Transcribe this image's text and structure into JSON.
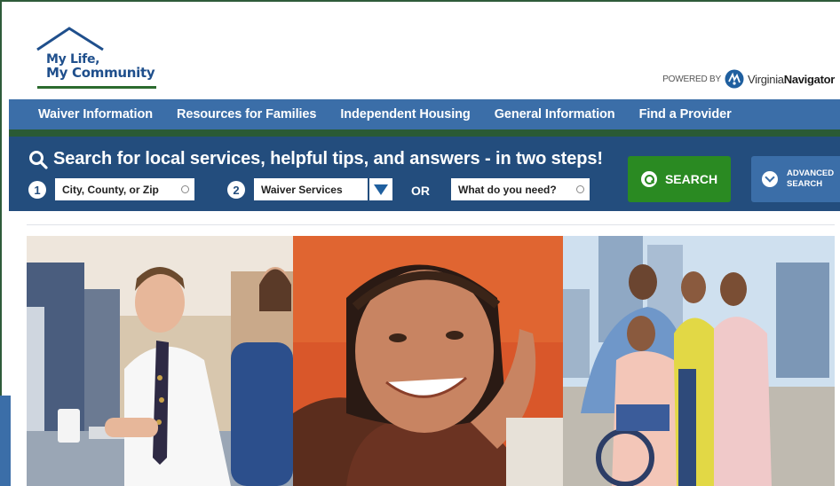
{
  "header": {
    "logo": {
      "line1": "My Life,",
      "line2": "My Community"
    },
    "powered_by": {
      "label": "POWERED BY",
      "brand_light": "Virginia",
      "brand_bold": "Navigator"
    }
  },
  "nav": {
    "items": [
      {
        "label": "Waiver Information"
      },
      {
        "label": "Resources for Families"
      },
      {
        "label": "Independent Housing"
      },
      {
        "label": "General Information"
      },
      {
        "label": "Find a Provider"
      }
    ]
  },
  "search": {
    "title": "Search for local services, helpful tips, and answers - in two steps!",
    "step1": {
      "number": "1",
      "value": "City, County, or Zip"
    },
    "step2": {
      "number": "2",
      "value": "Waiver Services"
    },
    "or_label": "OR",
    "need_field": {
      "value": "What do you need?"
    },
    "search_button": "SEARCH",
    "advanced_button": {
      "line1": "ADVANCED",
      "line2": "SEARCH"
    }
  },
  "photos": [
    {
      "icon": "photo-man-at-computer"
    },
    {
      "icon": "photo-smiling-woman"
    },
    {
      "icon": "photo-family-group"
    }
  ],
  "colors": {
    "nav_blue": "#3b6ea8",
    "search_band": "#234d7d",
    "search_green": "#2a8a22",
    "accent_green": "#2a5a35"
  }
}
